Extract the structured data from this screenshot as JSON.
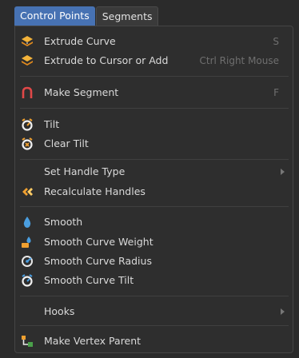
{
  "tabs": [
    {
      "label": "Control Points"
    },
    {
      "label": "Segments"
    }
  ],
  "menu": {
    "items": [
      {
        "label": "Extrude Curve",
        "shortcut": "S",
        "icon": "extrude-icon"
      },
      {
        "label": "Extrude to Cursor or Add",
        "shortcut": "Ctrl Right Mouse",
        "icon": "extrude-icon"
      },
      {
        "label": "Make Segment",
        "shortcut": "F",
        "icon": "make-segment-icon"
      },
      {
        "label": "Tilt",
        "shortcut": "",
        "icon": "tilt-icon"
      },
      {
        "label": "Clear Tilt",
        "shortcut": "",
        "icon": "clear-tilt-icon"
      },
      {
        "label": "Set Handle Type",
        "shortcut": "",
        "icon": ""
      },
      {
        "label": "Recalculate Handles",
        "shortcut": "",
        "icon": "recalc-handles-icon"
      },
      {
        "label": "Smooth",
        "shortcut": "",
        "icon": "smooth-drop-icon"
      },
      {
        "label": "Smooth Curve Weight",
        "shortcut": "",
        "icon": "smooth-weight-icon"
      },
      {
        "label": "Smooth Curve Radius",
        "shortcut": "",
        "icon": "smooth-radius-icon"
      },
      {
        "label": "Smooth Curve Tilt",
        "shortcut": "",
        "icon": "smooth-tilt-icon"
      },
      {
        "label": "Hooks",
        "shortcut": "",
        "icon": ""
      },
      {
        "label": "Make Vertex Parent",
        "shortcut": "",
        "icon": "vertex-parent-icon"
      }
    ]
  },
  "colors": {
    "accent": "#4772b3",
    "menu_bg": "#2e2e2e",
    "text": "#dadada",
    "shortcut": "#6f6f6f",
    "icon_orange": "#f0a030",
    "icon_blue": "#4a9ee0",
    "icon_red": "#e04848"
  }
}
